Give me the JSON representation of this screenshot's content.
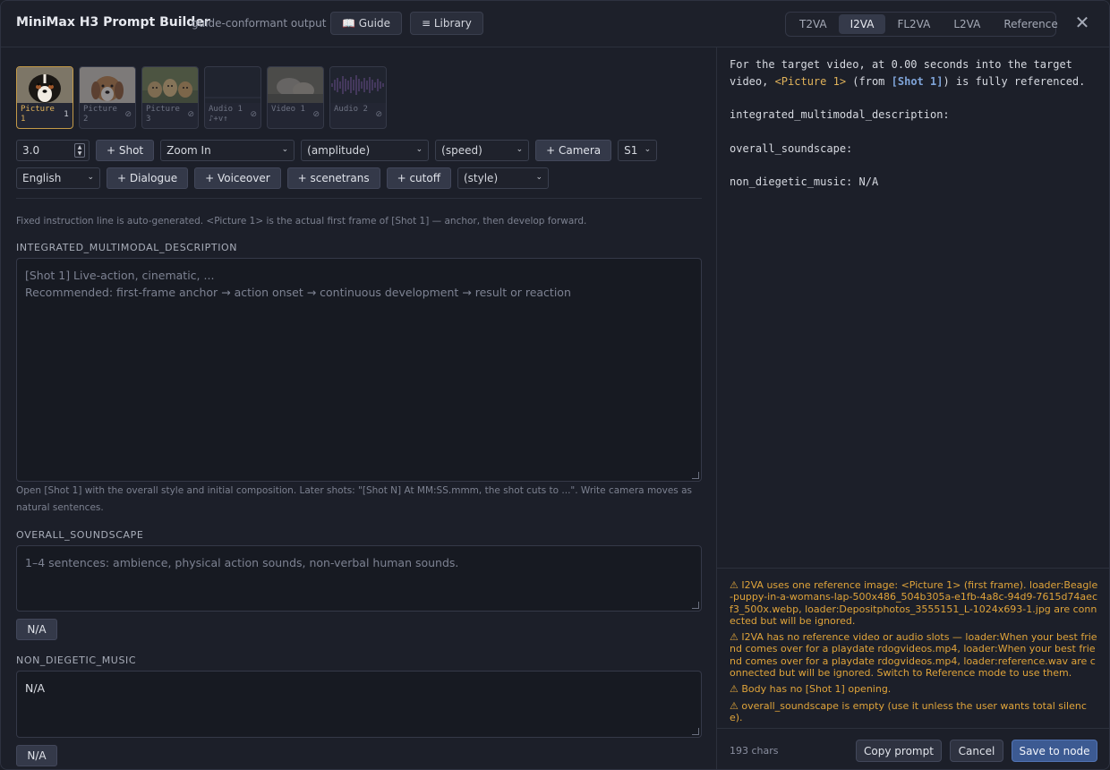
{
  "header": {
    "title": "MiniMax H3 Prompt Builder",
    "subtitle": "guide-conformant output",
    "guide_label": "📖 Guide",
    "library_label": "≡ Library",
    "modes": [
      "T2VA",
      "I2VA",
      "FL2VA",
      "L2VA",
      "Reference"
    ],
    "active_mode": "I2VA",
    "close_label": "✕"
  },
  "media": [
    {
      "label": "Picture 1",
      "badge": "1",
      "kind": "dog-bernese",
      "selected": true
    },
    {
      "label": "Picture 2",
      "badge": "⊘",
      "kind": "dog-beagle",
      "selected": false
    },
    {
      "label": "Picture 3",
      "badge": "⊘",
      "kind": "dogs-group",
      "selected": false
    },
    {
      "label": "Audio 1 ♪+v↑",
      "badge": "⊘",
      "kind": "audio-dark",
      "selected": false
    },
    {
      "label": "Video 1",
      "badge": "⊘",
      "kind": "video",
      "selected": false
    },
    {
      "label": "Audio 2",
      "badge": "⊘",
      "kind": "audio-wave",
      "selected": false
    }
  ],
  "controls": {
    "duration": "3.0",
    "add_shot": "+ Shot",
    "camera_move": "Zoom In",
    "amplitude": "(amplitude)",
    "speed": "(speed)",
    "add_camera": "+ Camera",
    "shot_select": "S1",
    "language": "English",
    "add_dialogue": "+ Dialogue",
    "add_voiceover": "+ Voiceover",
    "add_scenetrans": "+ scenetrans",
    "add_cutoff": "+ cutoff",
    "style": "(style)"
  },
  "hints": {
    "instruction": "Fixed instruction line is auto-generated. <Picture 1> is the actual first frame of [Shot 1] — anchor, then develop forward.",
    "description_help": "Open [Shot 1] with the overall style and initial composition. Later shots: \"[Shot N] At MM:SS.mmm, the shot cuts to ...\". Write camera moves as natural sentences."
  },
  "sections": {
    "description_title": "INTEGRATED_MULTIMODAL_DESCRIPTION",
    "description_placeholder_1": "[Shot 1] Live-action, cinematic, ...",
    "description_placeholder_2": "Recommended: first-frame anchor → action onset → continuous development → result or reaction",
    "soundscape_title": "OVERALL_SOUNDSCAPE",
    "soundscape_placeholder": "1–4 sentences: ambience, physical action sounds, non-verbal human sounds.",
    "music_title": "NON_DIEGETIC_MUSIC",
    "music_value": "N/A",
    "na_label": "N/A"
  },
  "preview": {
    "line1_a": "For the target video, at 0.00 seconds into the target video, ",
    "pic_ref": "<Picture 1>",
    "line1_b": " (from ",
    "shot_ref": "[Shot 1]",
    "line1_c": ") is fully referenced.",
    "line2": "integrated_multimodal_description:",
    "line3": "overall_soundscape:",
    "line4": "non_diegetic_music: N/A"
  },
  "warnings": [
    "⚠ I2VA uses one reference image: <Picture 1> (first frame). loader:Beagle-puppy-in-a-womans-lap-500x486_504b305a-e1fb-4a8c-94d9-7615d74aecf3_500x.webp, loader:Depositphotos_3555151_L-1024x693-1.jpg are connected but will be ignored.",
    "⚠ I2VA has no reference video or audio slots — loader:When your best friend comes over for a playdate rdogvideos.mp4, loader:When your best friend comes over for a playdate rdogvideos.mp4, loader:reference.wav are connected but will be ignored. Switch to Reference mode to use them.",
    "⚠ Body has no [Shot 1] opening.",
    "⚠ overall_soundscape is empty (use it unless the user wants total silence)."
  ],
  "footer": {
    "char_count": "193 chars",
    "copy_label": "Copy prompt",
    "cancel_label": "Cancel",
    "save_label": "Save to node"
  }
}
